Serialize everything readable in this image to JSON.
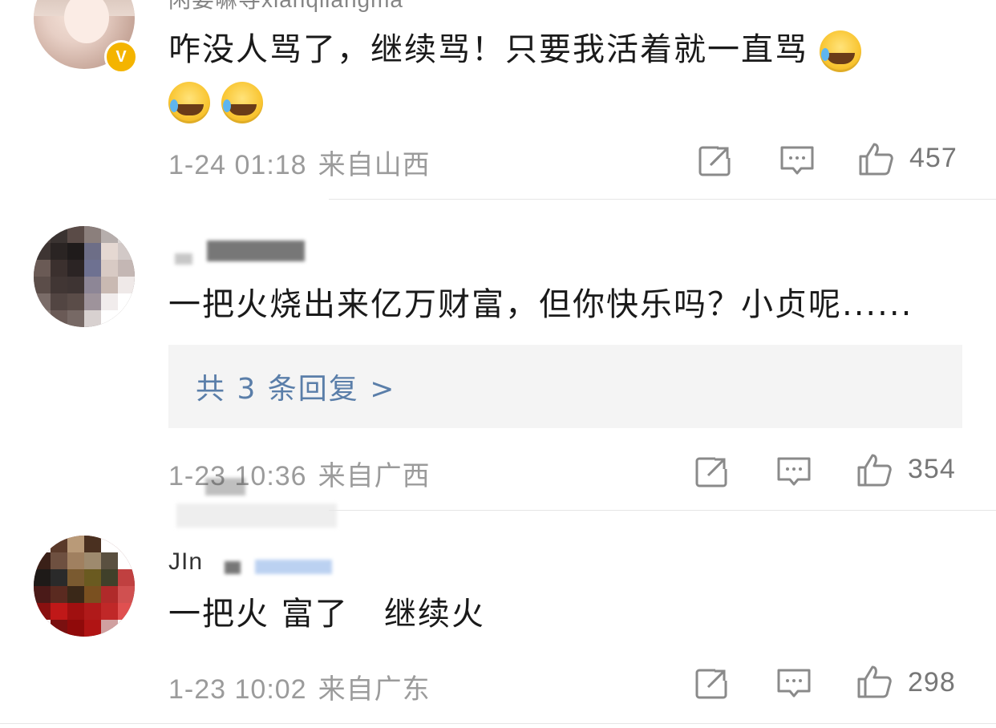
{
  "comments": [
    {
      "username": "闲要嘛导xianqilangma",
      "text_line1": "咋没人骂了，继续骂！只要我活着就一直骂",
      "emoji_names": [
        "laugh-cry-emoji",
        "laugh-cry-emoji",
        "laugh-cry-emoji"
      ],
      "time": "1-24 01:18",
      "location": "来自山西",
      "likes": "457"
    },
    {
      "username": "",
      "text_line1": "一把火烧出来亿万财富，但你快乐吗？小贞呢......",
      "replies_label": "共 3 条回复 >",
      "time": "1-23 10:36",
      "location": "来自广西",
      "likes": "354"
    },
    {
      "username": "JIn",
      "text_line1": "一把火 富了   继续火",
      "time": "1-23 10:02",
      "location": "来自广东",
      "likes": "298"
    }
  ],
  "colors": {
    "link": "#5a7ea9",
    "meta": "#9b9b9b",
    "verified": "#f4b400",
    "reply_box": "#f4f4f4"
  },
  "icons": [
    "share-icon",
    "comment-icon",
    "like-icon"
  ]
}
